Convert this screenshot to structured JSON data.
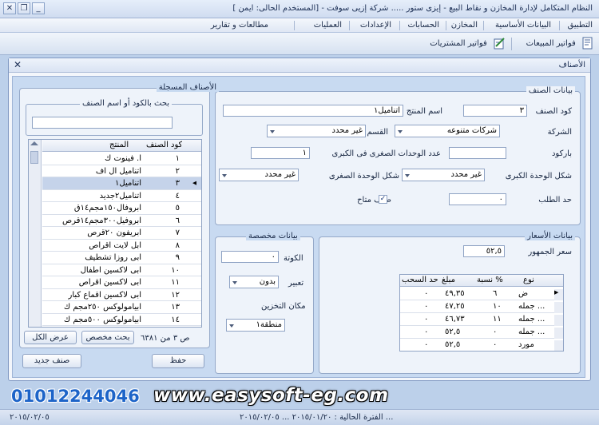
{
  "window": {
    "title": "النظام المتكامل لإدارة المخازن و نقاط البيع - إيزى ستور ..... شركة إزيى سوفت - [المستخدم الحالى: ايمن ]",
    "controls": {
      "minimize": "_",
      "restore": "❐",
      "close": "✕"
    }
  },
  "menu": [
    "التطبيق",
    "البيانات الأساسية",
    "المخازن",
    "الحسابات",
    "الإعدادات",
    "العمليات",
    "مطالعات و تقارير"
  ],
  "toolbar": {
    "sales_invoices": "فواتير المبيعات",
    "purchase_invoices": "فواتير المشتريات"
  },
  "child": {
    "title": "الأصناف",
    "close": "✕"
  },
  "item_data": {
    "group_title": "بيانات الصنف",
    "code_label": "كود الصنف",
    "code_value": "٣",
    "name_label": "اسم المنتج",
    "name_value": "اتناميل١",
    "company_label": "الشركة",
    "company_value": "شركات متنوعه",
    "category_label": "القسم",
    "category_value": "غير محدد",
    "barcode_label": "باركود",
    "barcode_value": "",
    "small_units_label": "عدد الوحدات الصغرى فى الكبرى",
    "small_units_value": "١",
    "big_unit_label": "شكل الوحدة الكبرى",
    "big_unit_value": "غير محدد",
    "small_unit_label": "شكل الوحدة الصغرى",
    "small_unit_value": "غير محدد",
    "reorder_label": "حد الطلب",
    "reorder_value": "٠",
    "available_label": "صنف متاح",
    "available_checked": "✓"
  },
  "prices": {
    "group_title": "بيانات الأسعار",
    "public_price_label": "سعر الجمهور",
    "public_price_value": "٥٢,٥",
    "columns": [
      "نوع",
      "نسبة %",
      "مبلغ",
      "حد السحب"
    ],
    "rows": [
      {
        "type": "ض",
        "pct": "٦",
        "amount": "٤٩,٣٥",
        "limit": "٠"
      },
      {
        "type": "جمله ...",
        "pct": "١٠",
        "amount": "٤٧,٢٥",
        "limit": "٠"
      },
      {
        "type": "جمله ...",
        "pct": "١١",
        "amount": "٤٦,٧٣",
        "limit": "٠"
      },
      {
        "type": "جمله ...",
        "pct": "٠",
        "amount": "٥٢,٥",
        "limit": "٠"
      },
      {
        "type": "مورد",
        "pct": "٠",
        "amount": "٥٢,٥",
        "limit": "٠"
      }
    ]
  },
  "special": {
    "group_title": "بيانات مخصصة",
    "quota_label": "الكوتة",
    "quota_value": "٠",
    "packaging_label": "تعبير",
    "packaging_value": "بدون",
    "storage_label": "مكان التخزين",
    "storage_value": "منطقة١"
  },
  "registered": {
    "group_title": "الأصناف المسجلة",
    "search_title": "بحث بالكود أو اسم الصنف",
    "search_value": "",
    "columns": [
      "كود الصنف",
      "المنتج"
    ],
    "rows": [
      {
        "code": "١",
        "name": "ا. فينوت ك"
      },
      {
        "code": "٢",
        "name": "اتناميل ال اف"
      },
      {
        "code": "٣",
        "name": "اتناميل١"
      },
      {
        "code": "٤",
        "name": "اتناميل٢جديد"
      },
      {
        "code": "٥",
        "name": "ابروفال١٥٠مجم١٤ق"
      },
      {
        "code": "٦",
        "name": "ابروفيل٣٠٠مجم١٤قرص"
      },
      {
        "code": "٧",
        "name": "ابريفون ٢٠قرص"
      },
      {
        "code": "٨",
        "name": "ابل لايت اقراص"
      },
      {
        "code": "٩",
        "name": "ابى روزا تشطيف"
      },
      {
        "code": "١٠",
        "name": "ابى لاكسين اطفال"
      },
      {
        "code": "١١",
        "name": "ابى لاكسين اقراص"
      },
      {
        "code": "١٢",
        "name": "ابى لاكسين اقماع كبار"
      },
      {
        "code": "١٣",
        "name": "ابيامولوكس ٢٥٠مجم ك"
      },
      {
        "code": "١٤",
        "name": "ابيامولوكس ٥٠٠مجم ك"
      }
    ],
    "count": "ص ٣ من ٦٣٨١",
    "custom_search_button": "بحث مخصص",
    "show_all_button": "عرض الكل"
  },
  "actions": {
    "save": "حفظ",
    "new_item": "صنف جديد"
  },
  "footer": {
    "website": "www.easysoft-eg.com",
    "phone": "01012244046",
    "status_left": "٢٠١٥/٠٢/٠٥",
    "status_period": "... الفترة الحالية : ٢٠١٥/٠١/٢٠ ... ٢٠١٥/٠٢/٠٥"
  },
  "colors": {
    "window_bg": "#bcd0ea",
    "content_bg": "#c8daf1",
    "selected_row": "#c5d3ea",
    "phone": "#1d64c8"
  }
}
